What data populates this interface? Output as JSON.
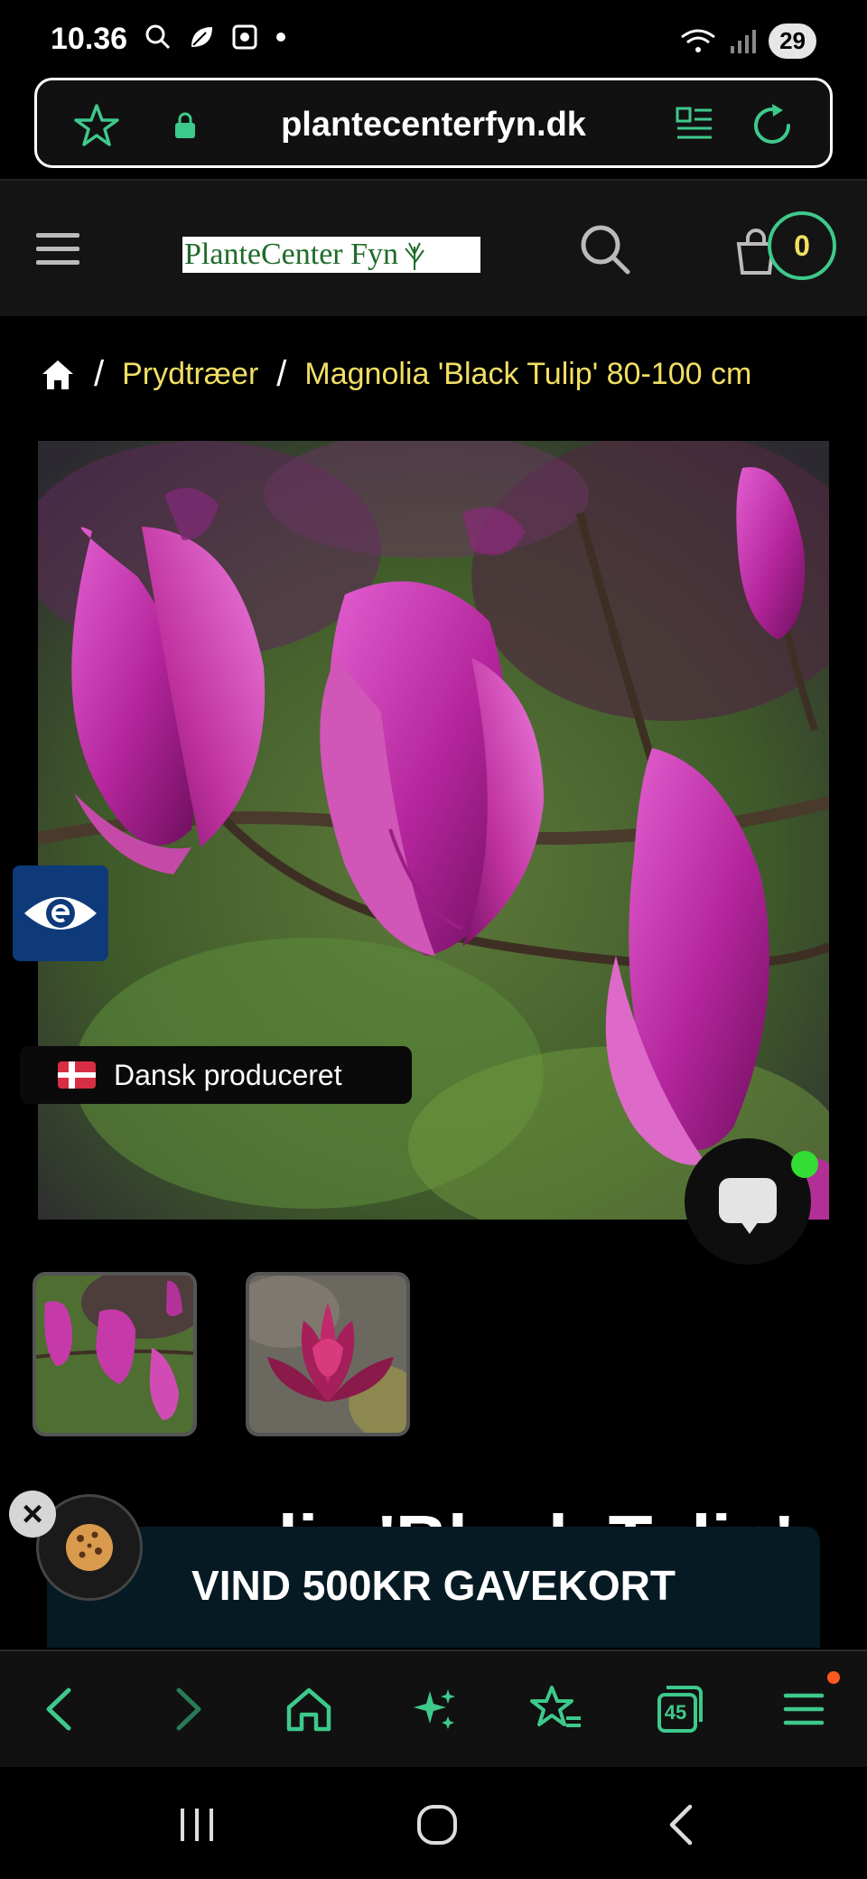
{
  "status_bar": {
    "time": "10.36",
    "battery": "29"
  },
  "browser": {
    "url": "plantecenterfyn.dk",
    "tabs_count": "45",
    "accent_color": "#3ec98c"
  },
  "header": {
    "logo_text": "PlanteCenter Fyn",
    "cart_count": "0"
  },
  "breadcrumb": {
    "category": "Prydtræer",
    "current": "Magnolia 'Black Tulip' 80-100 cm"
  },
  "product": {
    "badge": "Dansk produceret",
    "title_peek": "Magnolia 'Black Tulip'"
  },
  "promo": {
    "text": "VIND 500KR GAVEKORT"
  },
  "icons": [
    "search-icon",
    "star-icon",
    "lock-icon",
    "reader-icon",
    "reload-icon",
    "menu-icon",
    "cart-icon",
    "home-icon",
    "eye-icon",
    "chat-icon",
    "cookie-icon",
    "close-icon",
    "back-icon",
    "forward-icon",
    "sparkle-icon",
    "bookmarks-icon",
    "tabs-icon"
  ]
}
